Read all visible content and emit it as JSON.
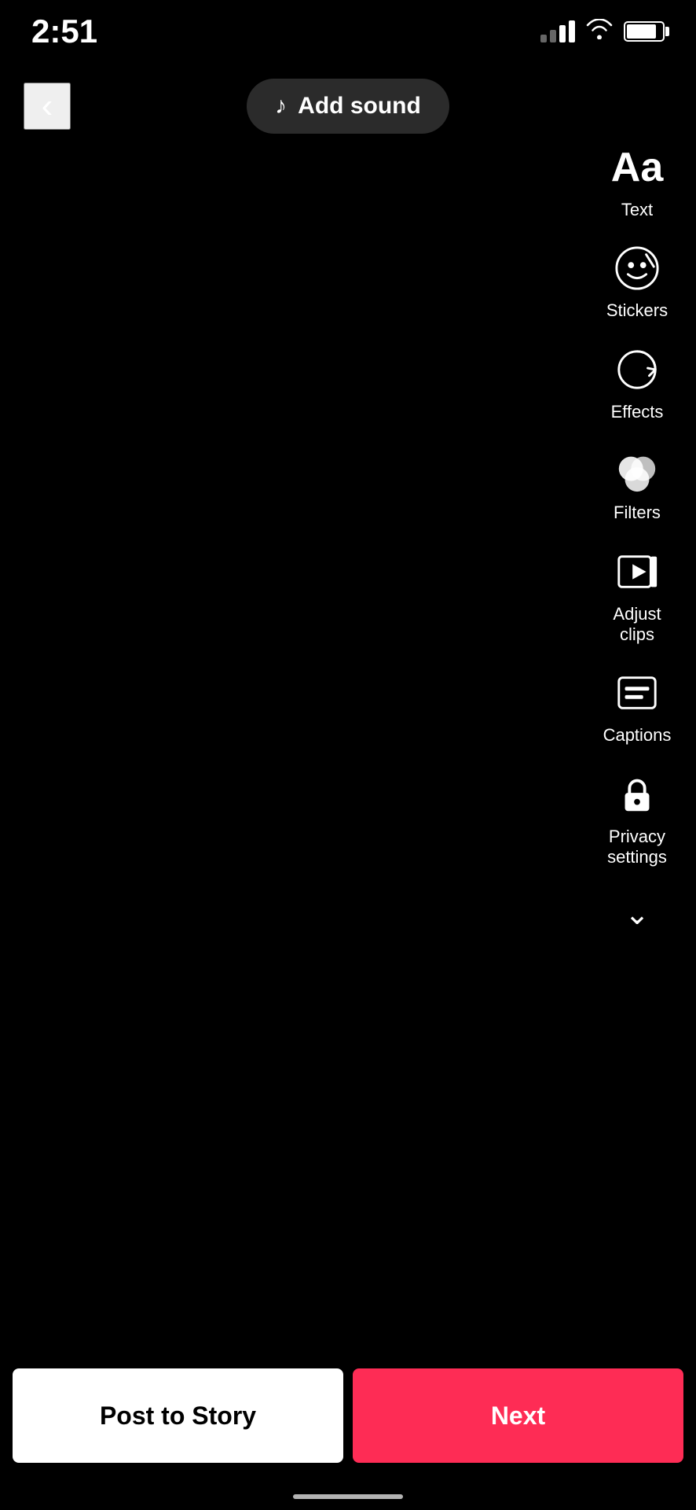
{
  "status": {
    "time": "2:51",
    "battery_percent": 85
  },
  "header": {
    "back_label": "‹",
    "add_sound_label": "Add sound"
  },
  "toolbar": {
    "items": [
      {
        "id": "text",
        "label": "Text",
        "icon_type": "text"
      },
      {
        "id": "stickers",
        "label": "Stickers",
        "icon_type": "stickers"
      },
      {
        "id": "effects",
        "label": "Effects",
        "icon_type": "effects"
      },
      {
        "id": "filters",
        "label": "Filters",
        "icon_type": "filters"
      },
      {
        "id": "adjust_clips",
        "label": "Adjust clips",
        "icon_type": "adjust_clips"
      },
      {
        "id": "captions",
        "label": "Captions",
        "icon_type": "captions"
      },
      {
        "id": "privacy_settings",
        "label": "Privacy\nsettings",
        "icon_type": "privacy"
      }
    ],
    "more_label": "chevron-down"
  },
  "bottom": {
    "post_to_story_label": "Post to Story",
    "next_label": "Next"
  }
}
